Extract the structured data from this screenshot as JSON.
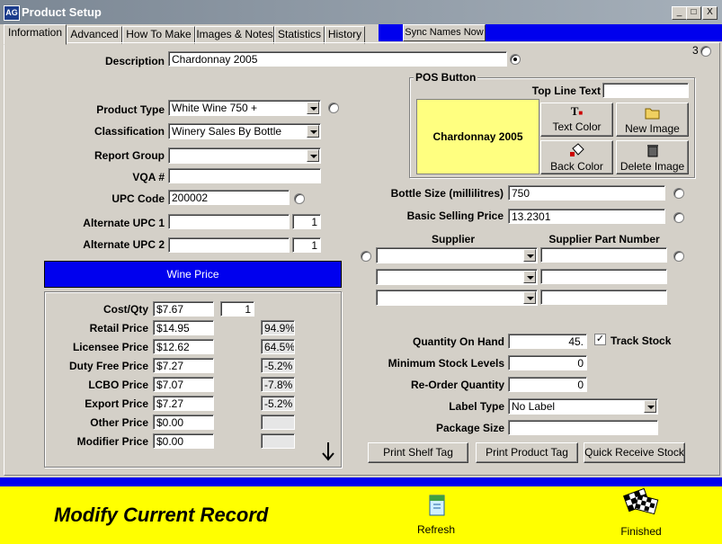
{
  "window": {
    "title": "Product Setup",
    "app_icon": "AG",
    "minimize": "_",
    "maximize": "□",
    "close": "X"
  },
  "tabs": [
    "Information",
    "Advanced",
    "How To Make",
    "Images & Notes",
    "Statistics",
    "History"
  ],
  "sync_button": "Sync Names Now",
  "corner_label": "3",
  "description": {
    "label": "Description",
    "value": "Chardonnay 2005"
  },
  "product_type": {
    "label": "Product Type",
    "value": "White Wine 750 +"
  },
  "classification": {
    "label": "Classification",
    "value": "Winery Sales By Bottle"
  },
  "report_group": {
    "label": "Report Group",
    "value": ""
  },
  "vqa": {
    "label": "VQA #",
    "value": ""
  },
  "upc": {
    "label": "UPC Code",
    "value": "200002"
  },
  "alt_upc1": {
    "label": "Alternate UPC 1",
    "value": "",
    "qty": "1"
  },
  "alt_upc2": {
    "label": "Alternate UPC 2",
    "value": "",
    "qty": "1"
  },
  "pos_button": {
    "group_label": "POS Button",
    "top_line_label": "Top Line Text",
    "top_line_value": "",
    "preview_text": "Chardonnay 2005",
    "preview_color": "#ffff80",
    "text_color_btn": "Text Color",
    "new_image_btn": "New Image",
    "back_color_btn": "Back Color",
    "delete_image_btn": "Delete Image"
  },
  "bottle_size": {
    "label": "Bottle Size (millilitres)",
    "value": "750"
  },
  "basic_price": {
    "label": "Basic Selling Price",
    "value": "13.2301"
  },
  "supplier": {
    "col1": "Supplier",
    "col2": "Supplier Part Number",
    "rows": [
      "",
      "",
      ""
    ]
  },
  "wine_price": {
    "header": "Wine Price",
    "cost_label": "Cost/Qty",
    "cost_value": "$7.67",
    "cost_qty": "1",
    "rows": [
      {
        "label": "Retail Price",
        "value": "$14.95",
        "pct": "94.9%"
      },
      {
        "label": "Licensee Price",
        "value": "$12.62",
        "pct": "64.5%"
      },
      {
        "label": "Duty Free Price",
        "value": "$7.27",
        "pct": "-5.2%"
      },
      {
        "label": "LCBO Price",
        "value": "$7.07",
        "pct": "-7.8%"
      },
      {
        "label": "Export Price",
        "value": "$7.27",
        "pct": "-5.2%"
      },
      {
        "label": "Other Price",
        "value": "$0.00",
        "pct": ""
      },
      {
        "label": "Modifier Price",
        "value": "$0.00",
        "pct": ""
      }
    ]
  },
  "stock": {
    "qoh_label": "Quantity On Hand",
    "qoh_value": "45.",
    "track_label": "Track Stock",
    "min_label": "Minimum Stock Levels",
    "min_value": "0",
    "reorder_label": "Re-Order Quantity",
    "reorder_value": "0",
    "label_type_label": "Label Type",
    "label_type_value": "No Label",
    "package_label": "Package Size",
    "package_value": ""
  },
  "actions": {
    "shelf": "Print Shelf Tag",
    "product": "Print Product Tag",
    "receive": "Quick Receive Stock"
  },
  "footer": {
    "mode_text": "Modify Current Record",
    "refresh": "Refresh",
    "finished": "Finished"
  },
  "colors": {
    "accent_blue": "#0000ee",
    "footer_yellow": "#ffff00",
    "pos_yellow": "#ffff80"
  }
}
